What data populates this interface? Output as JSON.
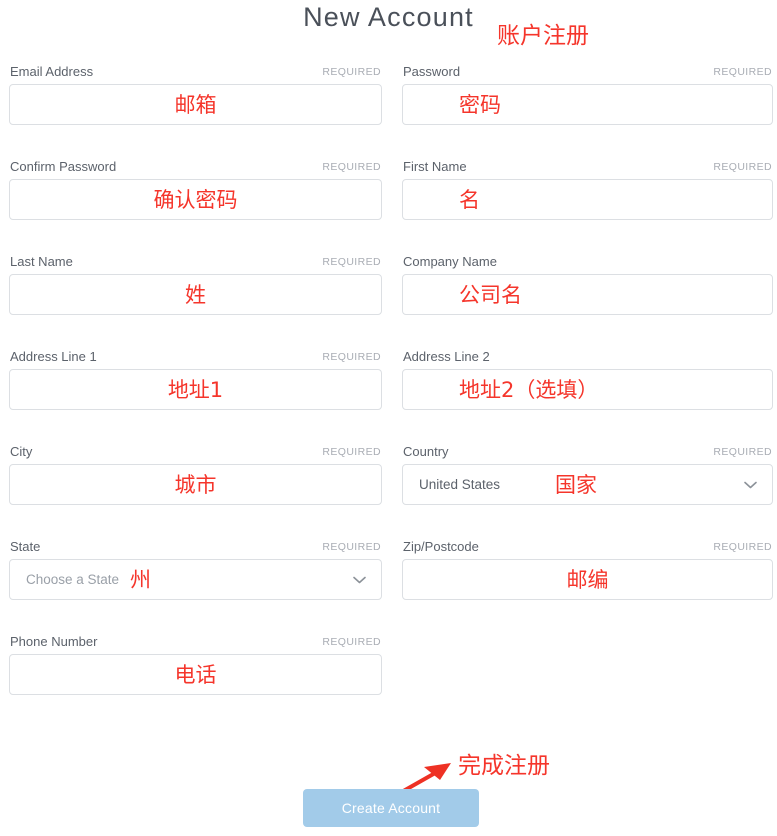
{
  "header": {
    "title": "New Account",
    "title_annotation": "账户注册",
    "title_color": "#4a5059",
    "annotation_color": "#f5352b"
  },
  "form": {
    "required_tag": "REQUIRED",
    "rows": [
      {
        "left": {
          "label": "Email Address",
          "required": true,
          "type": "text",
          "value": "",
          "annotation": "邮箱",
          "annotation_pos": "center"
        },
        "right": {
          "label": "Password",
          "required": true,
          "type": "text",
          "value": "",
          "annotation": "密码",
          "annotation_pos": "near-left"
        }
      },
      {
        "left": {
          "label": "Confirm Password",
          "required": true,
          "type": "text",
          "value": "",
          "annotation": "确认密码",
          "annotation_pos": "center"
        },
        "right": {
          "label": "First Name",
          "required": true,
          "type": "text",
          "value": "",
          "annotation": "名",
          "annotation_pos": "near-left"
        }
      },
      {
        "left": {
          "label": "Last Name",
          "required": true,
          "type": "text",
          "value": "",
          "annotation": "姓",
          "annotation_pos": "center"
        },
        "right": {
          "label": "Company Name",
          "required": false,
          "type": "text",
          "value": "",
          "annotation": "公司名",
          "annotation_pos": "near-left"
        }
      },
      {
        "left": {
          "label": "Address Line 1",
          "required": true,
          "type": "text",
          "value": "",
          "annotation": "地址1",
          "annotation_pos": "center"
        },
        "right": {
          "label": "Address Line 2",
          "required": false,
          "type": "text",
          "value": "",
          "annotation": "地址2（选填）",
          "annotation_pos": "near-left"
        }
      },
      {
        "left": {
          "label": "City",
          "required": true,
          "type": "text",
          "value": "",
          "annotation": "城市",
          "annotation_pos": "center"
        },
        "right": {
          "label": "Country",
          "required": true,
          "type": "select",
          "value": "United States",
          "placeholder": false,
          "annotation": "国家",
          "annotation_pos": "mid"
        }
      },
      {
        "left": {
          "label": "State",
          "required": true,
          "type": "select",
          "value": "Choose a State",
          "placeholder": true,
          "annotation": "州",
          "annotation_pos": "mid-left"
        },
        "right": {
          "label": "Zip/Postcode",
          "required": true,
          "type": "text",
          "value": "",
          "annotation": "邮编",
          "annotation_pos": "center"
        }
      },
      {
        "left": {
          "label": "Phone Number",
          "required": true,
          "type": "text",
          "value": "",
          "annotation": "电话",
          "annotation_pos": "center"
        },
        "right": null
      }
    ]
  },
  "footer": {
    "submit_label": "Create Account",
    "submit_color": "#a2cbe9",
    "submit_text_color": "#ffffff",
    "annotation": "完成注册",
    "annotation_color": "#f5352b",
    "arrow_color": "#ee3124"
  },
  "icons": {
    "chevron_down": "chevron-down-icon",
    "arrow": "arrow-pointer-icon"
  }
}
